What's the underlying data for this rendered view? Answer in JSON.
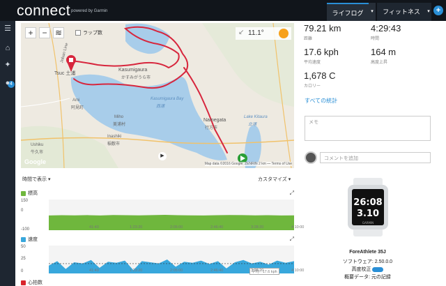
{
  "header": {
    "logo": "connect",
    "logo_sub": "powered by Garmin",
    "tab_lifelog": "ライフログ",
    "tab_fitness": "フィットネス",
    "arrow": "▾",
    "plus": "+"
  },
  "sidebar": {
    "badge": "4"
  },
  "map": {
    "zoom_in": "+",
    "zoom_out": "−",
    "layers": "≋",
    "lap_label": "ラップ数",
    "temperature": "11.1°",
    "labels": {
      "joban": "Joban Line",
      "tsuchiura": "Tsuc 土浦",
      "kasumigaura": "Kasumigaura",
      "kasumigaura_jp": "かすみがうら市",
      "ami": "Ami",
      "ami_jp": "阿見町",
      "miho": "Miho",
      "miho_jp": "美浦村",
      "bay": "Kasumigaura Bay",
      "bay_jp": "西浦",
      "namegata": "Namegata",
      "namegata_jp": "行方市",
      "inashiki": "Inashiki",
      "inashiki_jp": "稲敷市",
      "ushiku": "Ushiku",
      "ushiku_jp": "牛久市",
      "kitaura": "Lake Kitaura",
      "kitaura_jp": "北浦",
      "google": "Google"
    },
    "footer": "Map data ©2016 Google, ZENRIN   2 km ⎯⎯   Terms of Use"
  },
  "stats": {
    "distance": {
      "value": "79.21 km",
      "label": "距離"
    },
    "time": {
      "value": "4:29:43",
      "label": "時間"
    },
    "avg_speed": {
      "value": "17.6 kph",
      "label": "平均速度"
    },
    "elev_gain": {
      "value": "164 m",
      "label": "高度上昇"
    },
    "calories": {
      "value": "1,678 C",
      "label": "カロリー"
    },
    "all_stats_link": "すべての統計"
  },
  "memo_placeholder": "メモ",
  "comment_placeholder": "コメントを追加",
  "chart_controls": {
    "time_view": "時間で表示 ▾",
    "customize": "カスタマイズ ▾",
    "expand": "⤢"
  },
  "chart_data": [
    {
      "type": "area",
      "title": "標高",
      "color": "#6fb73d",
      "yticks": [
        "150",
        "0",
        "-100"
      ],
      "ylim": [
        -100,
        150
      ],
      "xticks": [
        "41:40",
        "1:23:20",
        "2:05:00",
        "2:46:40",
        "3:28:20",
        "4:10:00"
      ],
      "y": [
        20,
        22,
        21,
        23,
        20,
        24,
        22,
        21,
        23,
        25,
        22,
        21,
        20,
        22,
        24,
        23,
        21,
        22,
        20,
        21
      ]
    },
    {
      "type": "area",
      "title": "速度",
      "color": "#38a7dc",
      "yticks": [
        "50",
        "25",
        "0"
      ],
      "ylim": [
        0,
        50
      ],
      "xticks": [
        "41:40",
        "1:23:20",
        "2:05:00",
        "2:46:40",
        "3:28:20",
        "4:10:00"
      ],
      "avg_label": "平均 : 17.6 kph",
      "average": 17.6,
      "y": [
        14,
        22,
        8,
        20,
        18,
        24,
        10,
        21,
        19,
        23,
        6,
        22,
        20,
        18,
        25,
        12,
        21,
        19,
        23,
        17,
        22,
        9,
        20,
        24,
        18,
        21,
        16,
        23,
        19,
        22
      ]
    },
    {
      "type": "area",
      "title": "心拍数",
      "color": "#d9242c"
    }
  ],
  "device": {
    "time": "26:08",
    "date": "3.10",
    "brand": "GARMIN",
    "name": "ForeAthlete 35J",
    "software": "ソフトウェア: 2.50.0.0",
    "calibration": "高度校正",
    "summary": "概要データ: 元の記録"
  }
}
